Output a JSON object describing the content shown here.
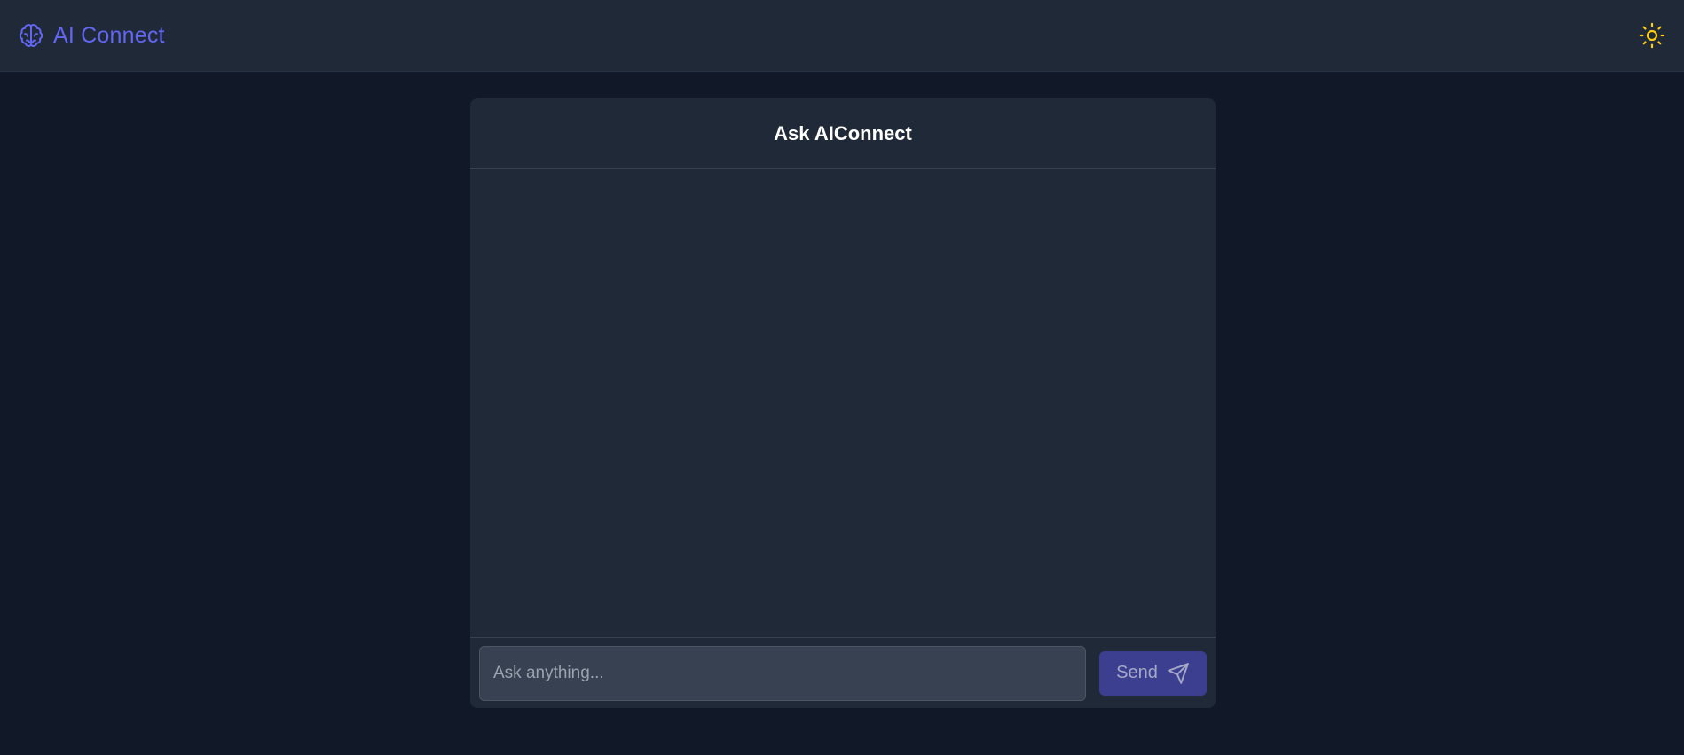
{
  "header": {
    "app_name": "AI Connect",
    "brand_icon": "brain-icon",
    "theme_toggle_icon": "sun-icon"
  },
  "chat": {
    "title": "Ask AIConnect",
    "messages": [],
    "input": {
      "placeholder": "Ask anything...",
      "value": ""
    },
    "send_label": "Send",
    "send_icon": "send-icon"
  },
  "colors": {
    "page_background": "#111827",
    "panel_background": "#1f2937",
    "brand": "#6366f1",
    "sun": "#facc15",
    "send_button": "#3c3f8f",
    "input_background": "#374151"
  }
}
